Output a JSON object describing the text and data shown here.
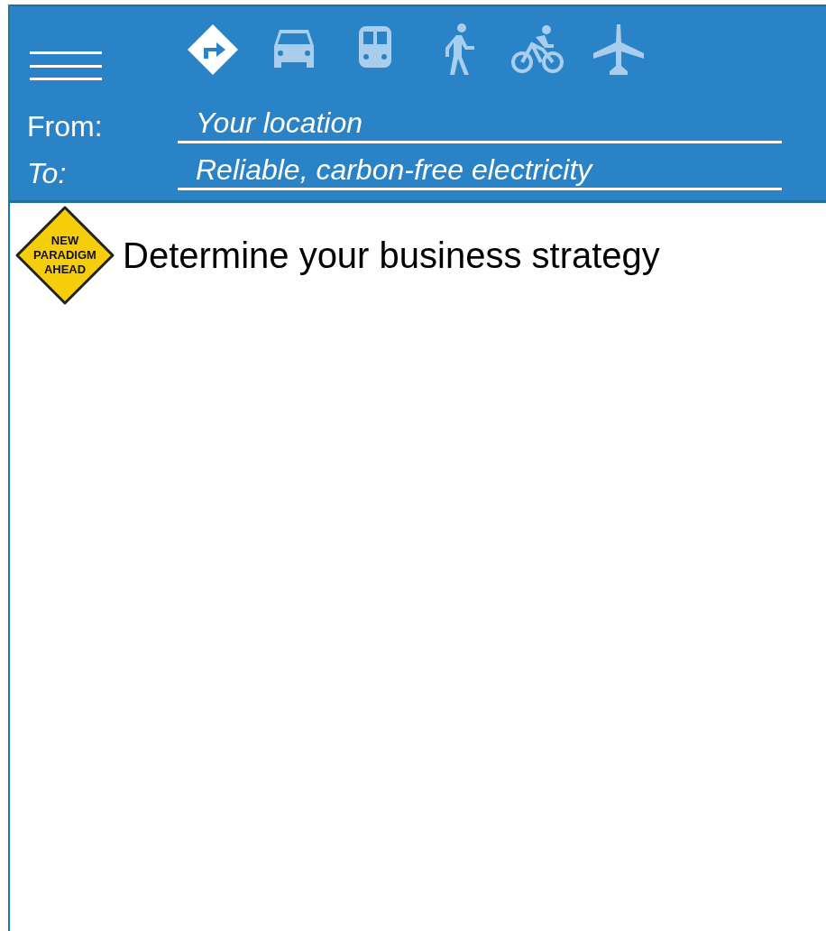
{
  "header": {
    "modes": [
      {
        "kind": "directions",
        "selected": true
      },
      {
        "kind": "car",
        "selected": false
      },
      {
        "kind": "train",
        "selected": false
      },
      {
        "kind": "walk",
        "selected": false
      },
      {
        "kind": "bike",
        "selected": false
      },
      {
        "kind": "plane",
        "selected": false
      }
    ],
    "fields": [
      {
        "label": "From:",
        "value": "Your location",
        "italic_label": false
      },
      {
        "label": "To:",
        "value": "Reliable, carbon-free electricity",
        "italic_label": true
      }
    ]
  },
  "sign": {
    "lines": [
      "NEW",
      "PARADIGM",
      "AHEAD"
    ]
  },
  "heading": "Determine your business strategy"
}
